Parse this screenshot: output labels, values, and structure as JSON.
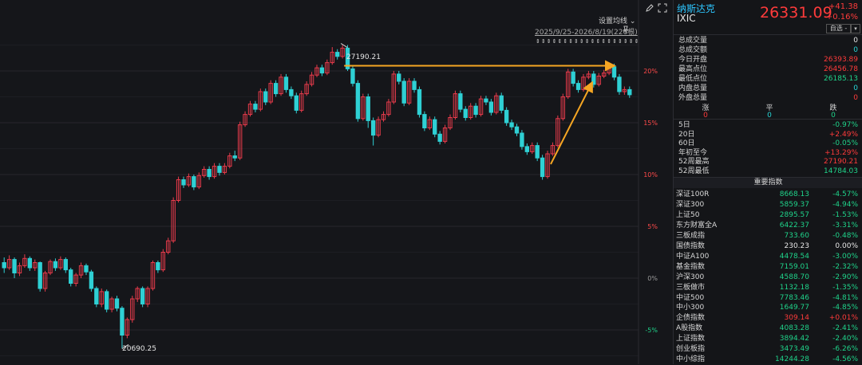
{
  "header": {
    "name": "纳斯达克",
    "code": "IXIC",
    "price": "26331.09",
    "change": "+41.38",
    "change_pct": "+0.16%",
    "watch_button": "自选 -",
    "menu_button": "▾"
  },
  "toolbar": {
    "ma_settings": "设置均线",
    "range": "2025/9/25-2026/8/19(226根)"
  },
  "chart_data": {
    "type": "candlestick",
    "y_axis_percent_ticks": [
      "20%",
      "15%",
      "10%",
      "5%",
      "0%",
      "-5%"
    ],
    "y_tick_values": [
      20,
      15,
      10,
      5,
      0,
      -5
    ],
    "annotations": {
      "high_label": "27190.21",
      "low_label": "20690.25"
    },
    "candles": [
      [
        1.5,
        1.0,
        2.0,
        0.5
      ],
      [
        1.0,
        1.8,
        2.2,
        0.8
      ],
      [
        1.8,
        0.5,
        2.0,
        0.0
      ],
      [
        0.5,
        1.2,
        1.5,
        0.2
      ],
      [
        1.2,
        1.9,
        2.3,
        1.0
      ],
      [
        1.9,
        1.0,
        2.1,
        0.7
      ],
      [
        1.0,
        1.5,
        1.8,
        0.7
      ],
      [
        1.5,
        -1.0,
        1.6,
        -1.3
      ],
      [
        -1.0,
        0.5,
        0.7,
        -1.3
      ],
      [
        0.5,
        1.6,
        1.8,
        0.3
      ],
      [
        1.6,
        1.0,
        1.9,
        0.7
      ],
      [
        1.0,
        1.8,
        2.1,
        0.8
      ],
      [
        1.8,
        0.8,
        2.0,
        0.5
      ],
      [
        0.8,
        -0.5,
        1.0,
        -0.8
      ],
      [
        -0.5,
        0.3,
        0.5,
        -0.8
      ],
      [
        0.3,
        1.2,
        1.5,
        0.0
      ],
      [
        1.2,
        0.6,
        1.4,
        0.3
      ],
      [
        0.6,
        -1.0,
        0.8,
        -1.3
      ],
      [
        -1.0,
        -2.5,
        -0.8,
        -2.8
      ],
      [
        -2.5,
        -1.3,
        -1.0,
        -2.8
      ],
      [
        -1.3,
        -3.0,
        -1.1,
        -3.3
      ],
      [
        -3.0,
        -2.0,
        -1.8,
        -3.3
      ],
      [
        -2.0,
        -2.9,
        -1.7,
        -3.2
      ],
      [
        -2.9,
        -5.5,
        -2.7,
        -6.8
      ],
      [
        -5.5,
        -4.0,
        -3.8,
        -5.8
      ],
      [
        -4.0,
        -2.0,
        -1.7,
        -4.3
      ],
      [
        -2.0,
        -1.0,
        -0.8,
        -2.3
      ],
      [
        -1.0,
        -2.5,
        -0.8,
        -2.8
      ],
      [
        -2.5,
        -1.0,
        -0.8,
        -2.8
      ],
      [
        -1.0,
        1.5,
        1.7,
        -1.2
      ],
      [
        1.5,
        0.8,
        1.7,
        0.5
      ],
      [
        0.8,
        2.5,
        2.8,
        0.6
      ],
      [
        2.5,
        3.6,
        3.9,
        2.3
      ],
      [
        3.6,
        7.5,
        7.8,
        3.4
      ],
      [
        7.5,
        9.5,
        9.8,
        7.3
      ],
      [
        9.5,
        9.0,
        9.8,
        8.7
      ],
      [
        9.0,
        9.8,
        10.1,
        8.8
      ],
      [
        9.8,
        8.8,
        10.0,
        8.5
      ],
      [
        8.8,
        9.9,
        10.2,
        8.6
      ],
      [
        9.9,
        10.5,
        10.8,
        9.7
      ],
      [
        10.5,
        9.8,
        10.8,
        9.5
      ],
      [
        9.8,
        10.8,
        11.1,
        9.6
      ],
      [
        10.8,
        10.2,
        11.1,
        9.9
      ],
      [
        10.2,
        10.8,
        11.1,
        10.0
      ],
      [
        10.8,
        11.8,
        12.1,
        10.6
      ],
      [
        11.8,
        11.6,
        12.3,
        11.3
      ],
      [
        11.6,
        14.8,
        15.1,
        11.4
      ],
      [
        14.8,
        15.8,
        16.1,
        14.6
      ],
      [
        15.8,
        16.8,
        17.1,
        15.6
      ],
      [
        16.8,
        16.3,
        17.1,
        16.0
      ],
      [
        16.3,
        18.0,
        18.3,
        16.1
      ],
      [
        18.0,
        17.0,
        18.3,
        16.7
      ],
      [
        17.0,
        18.8,
        19.1,
        16.8
      ],
      [
        18.8,
        17.8,
        19.1,
        17.5
      ],
      [
        17.8,
        19.4,
        19.7,
        17.6
      ],
      [
        19.4,
        18.2,
        19.7,
        17.9
      ],
      [
        18.2,
        17.6,
        18.5,
        17.3
      ],
      [
        17.6,
        16.2,
        17.9,
        15.9
      ],
      [
        16.2,
        17.8,
        18.1,
        16.0
      ],
      [
        17.8,
        18.7,
        19.0,
        17.6
      ],
      [
        18.7,
        19.6,
        19.9,
        18.5
      ],
      [
        19.6,
        20.3,
        20.6,
        19.4
      ],
      [
        20.3,
        19.8,
        20.6,
        19.5
      ],
      [
        19.8,
        20.8,
        21.1,
        19.6
      ],
      [
        20.8,
        21.8,
        22.3,
        20.6
      ],
      [
        21.8,
        21.4,
        22.1,
        21.1
      ],
      [
        21.4,
        22.2,
        22.5,
        21.2
      ],
      [
        22.2,
        20.2,
        22.5,
        20.0
      ],
      [
        20.2,
        18.8,
        20.5,
        18.5
      ],
      [
        18.8,
        15.4,
        19.1,
        15.1
      ],
      [
        15.4,
        17.5,
        17.8,
        15.2
      ],
      [
        17.5,
        15.2,
        17.8,
        14.5
      ],
      [
        15.2,
        13.8,
        15.5,
        12.8
      ],
      [
        13.8,
        15.3,
        15.6,
        13.6
      ],
      [
        15.3,
        15.8,
        16.1,
        15.1
      ],
      [
        15.8,
        17.0,
        17.3,
        15.6
      ],
      [
        17.0,
        19.7,
        20.0,
        16.8
      ],
      [
        19.7,
        19.0,
        20.0,
        18.7
      ],
      [
        19.0,
        16.9,
        19.3,
        16.6
      ],
      [
        16.9,
        19.0,
        19.3,
        16.7
      ],
      [
        19.0,
        18.2,
        19.3,
        17.9
      ],
      [
        18.2,
        15.8,
        18.5,
        15.5
      ],
      [
        15.8,
        14.5,
        16.1,
        14.2
      ],
      [
        14.5,
        15.3,
        15.6,
        14.3
      ],
      [
        15.3,
        13.9,
        15.6,
        13.6
      ],
      [
        13.9,
        13.2,
        14.2,
        12.9
      ],
      [
        13.2,
        14.5,
        14.8,
        13.0
      ],
      [
        14.5,
        15.5,
        15.8,
        14.3
      ],
      [
        15.5,
        17.8,
        18.1,
        15.3
      ],
      [
        17.8,
        16.3,
        18.1,
        16.0
      ],
      [
        16.3,
        15.5,
        16.6,
        15.2
      ],
      [
        15.5,
        16.6,
        16.9,
        15.3
      ],
      [
        16.6,
        15.8,
        16.9,
        15.5
      ],
      [
        15.8,
        17.3,
        17.6,
        15.6
      ],
      [
        17.3,
        17.0,
        17.6,
        16.7
      ],
      [
        17.0,
        16.0,
        17.3,
        15.7
      ],
      [
        16.0,
        17.6,
        17.9,
        15.8
      ],
      [
        17.6,
        16.2,
        17.9,
        15.9
      ],
      [
        16.2,
        15.0,
        16.5,
        14.7
      ],
      [
        15.0,
        14.6,
        15.3,
        14.3
      ],
      [
        14.6,
        14.0,
        14.9,
        13.7
      ],
      [
        14.0,
        12.7,
        14.3,
        12.4
      ],
      [
        12.7,
        12.2,
        13.0,
        11.9
      ],
      [
        12.2,
        12.8,
        13.1,
        12.0
      ],
      [
        12.8,
        11.6,
        13.1,
        11.3
      ],
      [
        11.6,
        9.8,
        11.9,
        9.5
      ],
      [
        9.8,
        12.0,
        12.3,
        9.6
      ],
      [
        12.0,
        12.8,
        13.1,
        11.8
      ],
      [
        12.8,
        15.4,
        15.7,
        12.6
      ],
      [
        15.4,
        17.5,
        17.8,
        15.2
      ],
      [
        17.5,
        19.9,
        20.2,
        17.3
      ],
      [
        19.9,
        18.8,
        20.2,
        18.5
      ],
      [
        18.8,
        18.2,
        19.1,
        17.9
      ],
      [
        18.2,
        19.4,
        19.7,
        18.0
      ],
      [
        19.4,
        19.7,
        20.0,
        19.2
      ],
      [
        19.7,
        18.7,
        20.0,
        18.4
      ],
      [
        18.7,
        19.5,
        19.8,
        18.5
      ],
      [
        19.5,
        19.8,
        20.1,
        19.3
      ],
      [
        19.8,
        20.4,
        20.7,
        19.6
      ],
      [
        20.4,
        19.4,
        20.7,
        19.1
      ],
      [
        19.4,
        18.0,
        19.7,
        17.7
      ],
      [
        18.0,
        18.2,
        18.5,
        17.7
      ],
      [
        18.2,
        17.7,
        18.5,
        17.4
      ]
    ]
  },
  "stats": [
    {
      "label": "总成交量",
      "value": "0",
      "color": "white"
    },
    {
      "label": "总成交额",
      "value": "0",
      "color": "cyan"
    },
    {
      "label": "今日开盘",
      "value": "26393.89",
      "color": "red"
    },
    {
      "label": "最高点位",
      "value": "26456.78",
      "color": "red"
    },
    {
      "label": "最低点位",
      "value": "26185.13",
      "color": "green"
    },
    {
      "label": "内盘总量",
      "value": "0",
      "color": "cyan"
    },
    {
      "label": "外盘总量",
      "value": "0",
      "color": "red"
    }
  ],
  "breadth": {
    "labels": [
      "涨",
      "平",
      "跌"
    ],
    "values": [
      "0",
      "0",
      "0"
    ]
  },
  "periods": [
    {
      "label": "5日",
      "value": "-0.97%",
      "color": "green"
    },
    {
      "label": "20日",
      "value": "+2.49%",
      "color": "red"
    },
    {
      "label": "60日",
      "value": "-0.05%",
      "color": "green"
    },
    {
      "label": "年初至今",
      "value": "+13.29%",
      "color": "red"
    },
    {
      "label": "52周最高",
      "value": "27190.21",
      "color": "red"
    },
    {
      "label": "52周最低",
      "value": "14784.03",
      "color": "green"
    }
  ],
  "index_section_title": "重要指数",
  "indices": [
    {
      "name": "深证100R",
      "price": "8668.13",
      "change": "-4.57%",
      "color": "green"
    },
    {
      "name": "深证300",
      "price": "5859.37",
      "change": "-4.94%",
      "color": "green"
    },
    {
      "name": "上证50",
      "price": "2895.57",
      "change": "-1.53%",
      "color": "green"
    },
    {
      "name": "东方财富全A",
      "price": "6422.37",
      "change": "-3.31%",
      "color": "green"
    },
    {
      "name": "三板成指",
      "price": "733.60",
      "change": "-0.48%",
      "color": "green"
    },
    {
      "name": "国债指数",
      "price": "230.23",
      "change": "0.00%",
      "color": "white"
    },
    {
      "name": "中证A100",
      "price": "4478.54",
      "change": "-3.00%",
      "color": "green"
    },
    {
      "name": "基金指数",
      "price": "7159.01",
      "change": "-2.32%",
      "color": "green"
    },
    {
      "name": "沪深300",
      "price": "4588.70",
      "change": "-2.90%",
      "color": "green"
    },
    {
      "name": "三板做市",
      "price": "1132.18",
      "change": "-1.35%",
      "color": "green"
    },
    {
      "name": "中证500",
      "price": "7783.46",
      "change": "-4.81%",
      "color": "green"
    },
    {
      "name": "中小300",
      "price": "1649.77",
      "change": "-4.85%",
      "color": "green"
    },
    {
      "name": "企债指数",
      "price": "309.14",
      "change": "+0.01%",
      "color": "red"
    },
    {
      "name": "A股指数",
      "price": "4083.28",
      "change": "-2.41%",
      "color": "green"
    },
    {
      "name": "上证指数",
      "price": "3894.42",
      "change": "-2.40%",
      "color": "green"
    },
    {
      "name": "创业板指",
      "price": "3473.49",
      "change": "-6.26%",
      "color": "green"
    },
    {
      "name": "中小综指",
      "price": "14244.28",
      "change": "-4.56%",
      "color": "green"
    }
  ],
  "colors": {
    "up": "#e83b4b",
    "down": "#2fd0d4",
    "arrow": "#f5a623",
    "grid": "#26272c"
  }
}
